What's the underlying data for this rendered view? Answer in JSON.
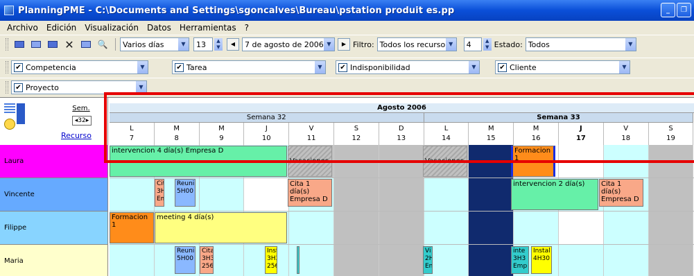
{
  "window": {
    "title": "PlanningPME - C:\\Documents and Settings\\sgoncalves\\Bureau\\pstation produit es.pp",
    "minimize": "_",
    "maximize": "❐"
  },
  "menu": [
    "Archivo",
    "Edición",
    "Visualización",
    "Datos",
    "Herramientas",
    "?"
  ],
  "toolbar1": {
    "range_select": "Varios días",
    "count": "13",
    "date_day": "7 de",
    "date_month": "agosto",
    "date_year": "de 2006",
    "filter_label": "Filtro:",
    "filter_value": "Todos los recursos",
    "filter_count": "4",
    "state_label": "Estado:",
    "state_value": "Todos"
  },
  "toolbar2": {
    "filters": [
      "Competencia",
      "Tarea",
      "Indisponibilidad",
      "Cliente"
    ]
  },
  "toolbar3": {
    "filters": [
      "Proyecto"
    ]
  },
  "corner": {
    "sem_label": "Sem.",
    "sem_value": "◂32▸",
    "recurso_label": "Recurso"
  },
  "calendar": {
    "month": "Agosto 2006",
    "weeks": [
      {
        "label": "Semana 32",
        "span": 7,
        "bold": false
      },
      {
        "label": "Semana 33",
        "span": 6,
        "bold": true
      }
    ],
    "days": [
      {
        "letter": "L",
        "num": "7"
      },
      {
        "letter": "M",
        "num": "8"
      },
      {
        "letter": "M",
        "num": "9"
      },
      {
        "letter": "J",
        "num": "10"
      },
      {
        "letter": "V",
        "num": "11"
      },
      {
        "letter": "S",
        "num": "12"
      },
      {
        "letter": "D",
        "num": "13"
      },
      {
        "letter": "L",
        "num": "14"
      },
      {
        "letter": "M",
        "num": "15"
      },
      {
        "letter": "M",
        "num": "16"
      },
      {
        "letter": "J",
        "num": "17",
        "bold": true
      },
      {
        "letter": "V",
        "num": "18"
      },
      {
        "letter": "S",
        "num": "19"
      }
    ]
  },
  "resources": [
    {
      "name": "Laura",
      "color": "#ff00ff"
    },
    {
      "name": "Vincente",
      "color": "#66aaff"
    },
    {
      "name": "Filippe",
      "color": "#88d4ff"
    },
    {
      "name": "Maria",
      "color": "#ffffcc"
    }
  ],
  "tasks": {
    "laura_1": "intervencion  4 día(s)  Empresa D",
    "laura_vac1": "Vacaciones",
    "laura_vac2": "Vacaciones",
    "laura_form": "Formacion  1",
    "vin_cita1": "Cit 3H Em",
    "vin_reu": "Reuni 5H00",
    "vin_cita2": "Cita  1 día(s) Empresa D",
    "vin_interv": "intervencion  2 día(s)",
    "vin_cita3": "Cita  1 día(s) Empresa D",
    "fil_form": "Formacion  1",
    "fil_meet": "meeting  4 día(s)",
    "mar_reu": "Reuni 5H00",
    "mar_cita": "Cita 3H3 256",
    "mar_inst": "Inst 3H3 256",
    "mar_v": "Vi 2H En",
    "mar_inte": "inte 3H3 Emp",
    "mar_instal": "Instal 4H30"
  }
}
